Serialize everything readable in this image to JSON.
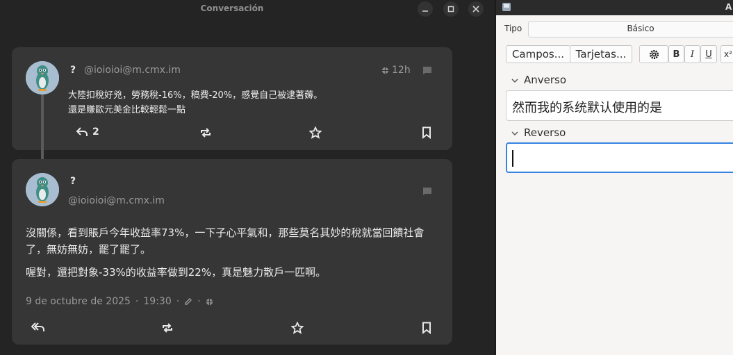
{
  "window": {
    "title": "Conversación"
  },
  "post1": {
    "name": "?",
    "handle": "@ioioioi@m.cmx.im",
    "time": "12h",
    "text_line1": "大陸扣稅好兇，勞務稅-16%，稿費-20%，感覺自己被逮著薅。",
    "text_line2": "還是賺歐元美金比較輕鬆一點",
    "reply_count": "2"
  },
  "post2": {
    "name": "?",
    "handle": "@ioioioi@m.cmx.im",
    "text_para1": "沒關係，看到賬戶今年收益率73%，一下子心平氣和，那些莫名其妙的稅就當回饋社會了，無妨無妨，罷了罷了。",
    "text_para2": "喔對，還把對象-33%的收益率做到22%，真是魅力散戶一匹啊。",
    "date": "9 de octubre de 2025",
    "time_sep": "·",
    "time": "19:30",
    "meta_sep": "·"
  },
  "anki": {
    "title": "A",
    "tipo_label": "Tipo",
    "tipo_value": "Básico",
    "campos_button": "Campos...",
    "tarjetas_button": "Tarjetas...",
    "bold_button": "B",
    "italic_button": "I",
    "underline_button": "U",
    "superscript_button": "x²",
    "anverso_label": "Anverso",
    "anverso_value": "然而我的系统默认使用的是",
    "reverso_label": "Reverso",
    "reverso_value": ""
  }
}
